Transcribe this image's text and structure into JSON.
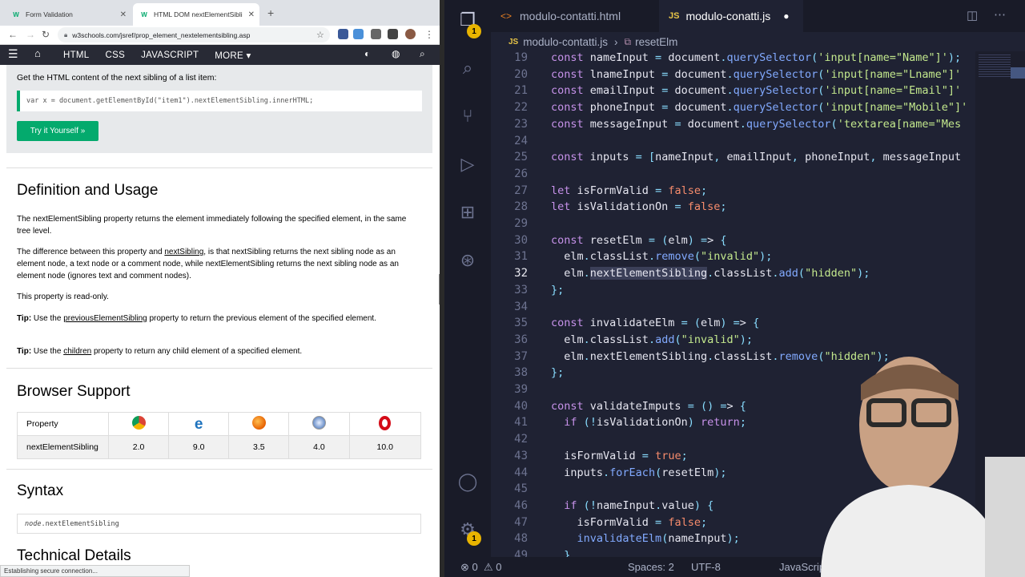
{
  "browser": {
    "tabs": [
      {
        "title": "Form Validation",
        "favicon": "W"
      },
      {
        "title": "HTML DOM nextElementSibli",
        "favicon": "W"
      }
    ],
    "url": "w3schools.com/jsref/prop_element_nextelementsibling.asp",
    "nav": [
      "HTML",
      "CSS",
      "JAVASCRIPT",
      "MORE ▾"
    ],
    "status": "Establishing secure connection..."
  },
  "page": {
    "example_intro": "Get the HTML content of the next sibling of a list item:",
    "example_code": "var x = document.getElementById(\"item1\").nextElementSibling.innerHTML;",
    "try_button": "Try it Yourself »",
    "h_definition": "Definition and Usage",
    "p1": "The nextElementSibling property returns the element immediately following the specified element, in the same tree level.",
    "p2_a": "The difference between this property and ",
    "p2_link": "nextSibling",
    "p2_b": ", is that nextSibling returns the next sibling node as an element node, a text node or a comment node, while nextElementSibling returns the next sibling node as an element node (ignores text and comment nodes).",
    "p3": "This property is read-only.",
    "tip1_label": "Tip:",
    "tip1_a": " Use the ",
    "tip1_link": "previousElementSibling",
    "tip1_b": " property to return the previous element of the specified element.",
    "tip2_label": "Tip:",
    "tip2_a": " Use the ",
    "tip2_link": "children",
    "tip2_b": " property to return any child element of a specified element.",
    "h_browser": "Browser Support",
    "table_header": "Property",
    "table_row_name": "nextElementSibling",
    "versions": [
      "2.0",
      "9.0",
      "3.5",
      "4.0",
      "10.0"
    ],
    "browser_icons": [
      "chrome-icon",
      "edge-icon",
      "firefox-icon",
      "safari-icon",
      "opera-icon"
    ],
    "h_syntax": "Syntax",
    "syntax_italic": "node",
    "syntax_rest": ".nextElementSibling",
    "h_technical": "Technical Details"
  },
  "vscode": {
    "tab1": "modulo-contatti.html",
    "tab2": "modulo-conatti.js",
    "bread_file": "modulo-contatti.js",
    "bread_symbol": "resetElm",
    "explorer_badge": "1",
    "settings_badge": "1",
    "status_errors": "0",
    "status_warnings": "0",
    "status_spaces": "Spaces: 2",
    "status_enc": "UTF-8",
    "status_lang": "JavaScript",
    "line_numbers": [
      "19",
      "20",
      "21",
      "22",
      "23",
      "24",
      "25",
      "26",
      "27",
      "28",
      "29",
      "30",
      "31",
      "32",
      "33",
      "34",
      "35",
      "36",
      "37",
      "38",
      "39",
      "40",
      "41",
      "42",
      "43",
      "44",
      "45",
      "46",
      "47",
      "48",
      "49"
    ],
    "code": [
      "const nameInput = document.querySelector('input[name=\"Name\"]');",
      "const lnameInput = document.querySelector('input[name=\"Lname\"]'",
      "const emailInput = document.querySelector('input[name=\"Email\"]'",
      "const phoneInput = document.querySelector('input[name=\"Mobile\"]'",
      "const messageInput = document.querySelector('textarea[name=\"Mes",
      "",
      "const inputs = [nameInput, emailInput, phoneInput, messageInput",
      "",
      "let isFormValid = false;",
      "let isValidationOn = false;",
      "",
      "const resetElm = (elm) => {",
      "  elm.classList.remove(\"invalid\");",
      "  elm.nextElementSibling.classList.add(\"hidden\");",
      "};",
      "",
      "const invalidateElm = (elm) => {",
      "  elm.classList.add(\"invalid\");",
      "  elm.nextElementSibling.classList.remove(\"hidden\");",
      "};",
      "",
      "const validateImputs = () => {",
      "  if (!isValidationOn) return;",
      "",
      "  isFormValid = true;",
      "  inputs.forEach(resetElm);",
      "",
      "  if (!nameInput.value) {",
      "    isFormValid = false;",
      "    invalidateElm(nameInput);",
      "  }"
    ]
  }
}
